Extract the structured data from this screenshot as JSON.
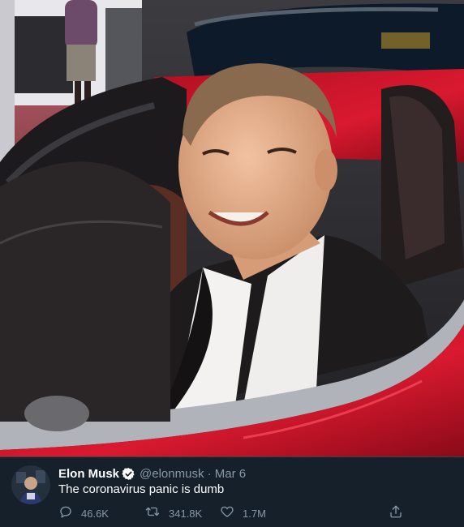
{
  "tweet": {
    "author_name": "Elon Musk",
    "handle": "@elonmusk · Mar 6",
    "text": "The coronavirus panic is dumb",
    "stats": {
      "replies": "46.6K",
      "retweets": "341.8K",
      "likes": "1.7M"
    }
  },
  "icons": {
    "verified": "verified-badge-icon",
    "reply": "speech-bubble-icon",
    "retweet": "retweet-arrows-icon",
    "like": "heart-outline-icon",
    "share": "share-upload-icon"
  },
  "colors": {
    "background": "#15202b",
    "primary_text": "#ffffff",
    "secondary_text": "#8899a6",
    "verified_badge": "#1da1f2",
    "car_red": "#c8142a"
  }
}
